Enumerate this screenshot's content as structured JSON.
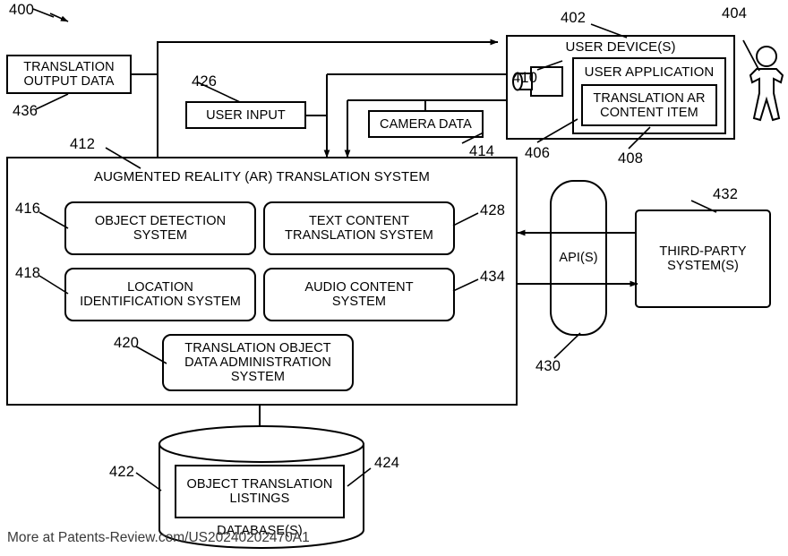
{
  "figure": {
    "number": "400",
    "watermark": "More at Patents-Review.com/US20240202470A1"
  },
  "blocks": {
    "translation_output_data": {
      "label": "TRANSLATION\nOUTPUT DATA",
      "ref": "436"
    },
    "user_input": {
      "label": "USER INPUT",
      "ref": "426"
    },
    "camera_data": {
      "label": "CAMERA DATA",
      "ref": "414"
    },
    "user_devices": {
      "label": "USER DEVICE(S)",
      "ref": "402"
    },
    "user_application": {
      "label": "USER APPLICATION",
      "ref": "406"
    },
    "translation_ar_content_item": {
      "label": "TRANSLATION AR\nCONTENT ITEM",
      "ref": "408"
    },
    "camera_icon": {
      "ref": "410"
    },
    "user_person": {
      "ref": "404"
    },
    "ar_translation_system": {
      "label": "AUGMENTED REALITY (AR) TRANSLATION SYSTEM",
      "ref": "412"
    },
    "object_detection_system": {
      "label": "OBJECT DETECTION\nSYSTEM",
      "ref": "416"
    },
    "text_content_translation_system": {
      "label": "TEXT CONTENT\nTRANSLATION SYSTEM",
      "ref": "428"
    },
    "location_identification_system": {
      "label": "LOCATION\nIDENTIFICATION SYSTEM",
      "ref": "418"
    },
    "audio_content_system": {
      "label": "AUDIO CONTENT\nSYSTEM",
      "ref": "434"
    },
    "translation_object_data_administration_system": {
      "label": "TRANSLATION OBJECT\nDATA ADMINISTRATION\nSYSTEM",
      "ref": "420"
    },
    "apis": {
      "label": "API(S)",
      "ref": "430"
    },
    "third_party_systems": {
      "label": "THIRD-PARTY\nSYSTEM(S)",
      "ref": "432"
    },
    "databases": {
      "label": "DATABASE(S)",
      "ref": "422"
    },
    "object_translation_listings": {
      "label": "OBJECT TRANSLATION\nLISTINGS",
      "ref": "424"
    }
  },
  "colors": {
    "stroke": "#000000",
    "background": "#ffffff",
    "watermark": "#3a3a3a"
  }
}
